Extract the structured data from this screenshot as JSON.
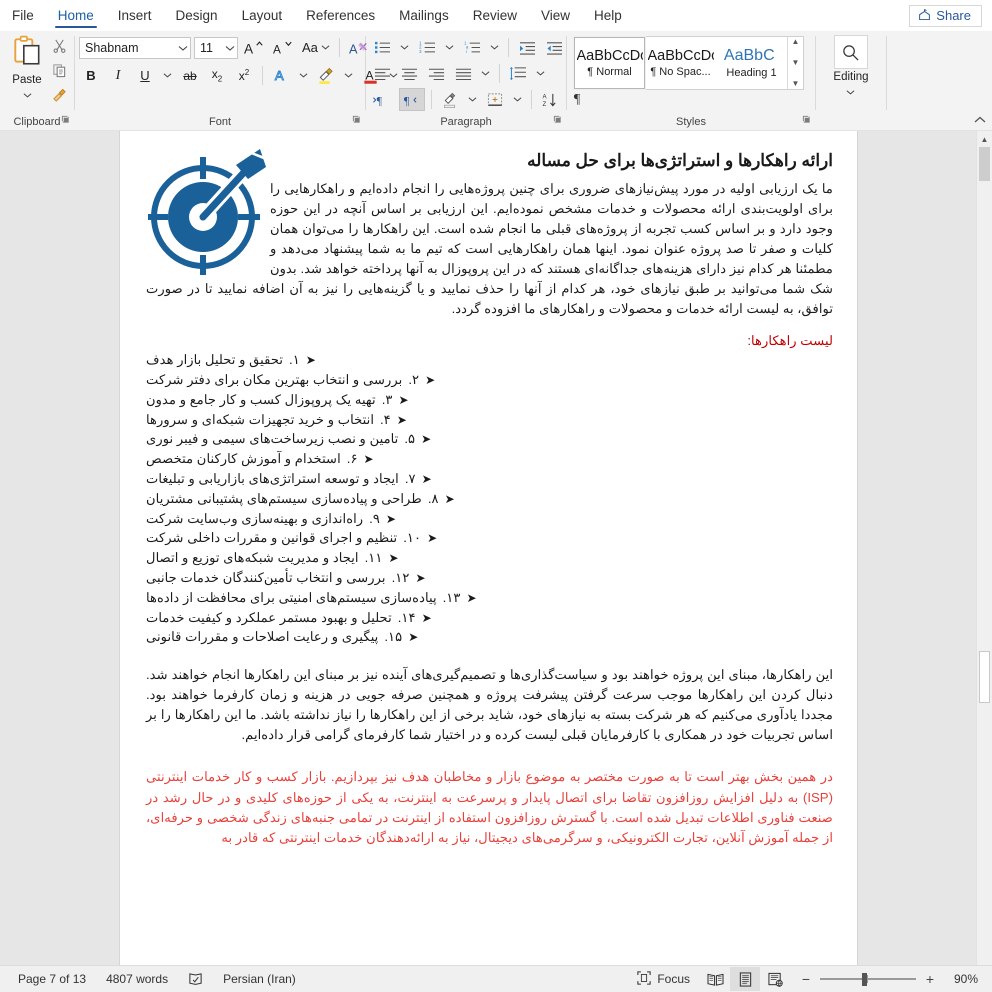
{
  "window": {
    "tabs": [
      {
        "label": "File",
        "active": false
      },
      {
        "label": "Home",
        "active": true
      },
      {
        "label": "Insert",
        "active": false
      },
      {
        "label": "Design",
        "active": false
      },
      {
        "label": "Layout",
        "active": false
      },
      {
        "label": "References",
        "active": false
      },
      {
        "label": "Mailings",
        "active": false
      },
      {
        "label": "Review",
        "active": false
      },
      {
        "label": "View",
        "active": false
      },
      {
        "label": "Help",
        "active": false
      }
    ],
    "share_label": "Share",
    "accent_color": "#2b579a"
  },
  "ribbon": {
    "clipboard": {
      "caption": "Clipboard",
      "paste_label": "Paste",
      "cut_name": "cut-icon",
      "copy_name": "copy-icon",
      "format_painter_name": "format-painter-icon",
      "dialog_launcher": "dialog-launcher-icon"
    },
    "font": {
      "caption": "Font",
      "font_name": "Shabnam",
      "font_size": "11",
      "grow_label": "A",
      "shrink_label": "A",
      "change_case_label": "Aa",
      "clear_format_label": "A",
      "bold_label": "B",
      "italic_label": "I",
      "underline_label": "U",
      "strikethrough_label": "ab",
      "subscript_label": "x",
      "superscript_label": "x",
      "text_effects_label": "A",
      "highlight_label": "highlight",
      "font_color_label": "A",
      "dialog_launcher": "dialog-launcher-icon"
    },
    "paragraph": {
      "caption": "Paragraph",
      "dialog_launcher": "dialog-launcher-icon",
      "rtl_active": true
    },
    "styles": {
      "caption": "Styles",
      "items": [
        {
          "preview": "AaBbCcDc",
          "name": "¶ Normal",
          "selected": true,
          "heading": false
        },
        {
          "preview": "AaBbCcDc",
          "name": "¶ No Spac...",
          "selected": false,
          "heading": false
        },
        {
          "preview": "AaBbC ",
          "name": "Heading 1",
          "selected": false,
          "heading": true
        }
      ],
      "dialog_launcher": "dialog-launcher-icon"
    },
    "editing": {
      "caption": "Editing",
      "label": "Editing"
    },
    "collapse_label": "⌃"
  },
  "document": {
    "heading": "ارائه راهکارها و استراتژی‌ها برای حل مساله",
    "image_alt": "target-and-arrow-graphic",
    "image_color": "#1a6099",
    "intro_paragraph": "ما یک ارزیابی اولیه در مورد پیش‌نیازهای ضروری برای چنین پروژه‌هایی را انجام داده‌ایم و راهکارهایی را برای اولویت‌بندی ارائه محصولات و خدمات مشخص نموده‌ایم. این ارزیابی بر اساس آنچه در این حوزه وجود دارد و بر اساس کسب تجربه از پروژه‌های قبلی ما انجام شده است. این راهکارها را می‌توان همان کلیات و صفر تا صد پروژه عنوان نمود. اینها همان راهکارهایی است که تیم ما به شما پیشنهاد می‌دهد و مطمئنا هر کدام نیز دارای هزینه‌های جداگانه‌ای هستند که در این پروپوزال به آنها پرداخته خواهد شد. بدون شک شما می‌توانید بر طبق نیازهای خود، هر کدام از آنها را حذف نمایید و یا گزینه‌هایی را نیز به آن اضافه نمایید تا در صورت توافق، به لیست ارائه خدمات و محصولات و راهکارهای ما افزوده گردد.",
    "list_title": "لیست راهکارها:",
    "list_title_color": "#c00000",
    "list_marker": "➤",
    "list_items": [
      {
        "num": "۱.",
        "text": "تحقیق و تحلیل بازار هدف"
      },
      {
        "num": "۲.",
        "text": "بررسی و انتخاب بهترین مکان برای دفتر شرکت"
      },
      {
        "num": "۳.",
        "text": "تهیه یک پروپوزال کسب و کار جامع و مدون"
      },
      {
        "num": "۴.",
        "text": "انتخاب و خرید تجهیزات شبکه‌ای و سرورها"
      },
      {
        "num": "۵.",
        "text": "تامین و نصب زیرساخت‌های سیمی و فیبر نوری"
      },
      {
        "num": "۶.",
        "text": "استخدام و آموزش کارکنان متخصص"
      },
      {
        "num": "۷.",
        "text": "ایجاد و توسعه استراتژی‌های بازاریابی و تبلیغات"
      },
      {
        "num": "۸.",
        "text": "طراحی و پیاده‌سازی سیستم‌های پشتیبانی مشتریان"
      },
      {
        "num": "۹.",
        "text": "راه‌اندازی و بهینه‌سازی وب‌سایت شرکت"
      },
      {
        "num": "۱۰.",
        "text": "تنظیم و اجرای قوانین و مقررات داخلی شرکت"
      },
      {
        "num": "۱۱.",
        "text": "ایجاد و مدیریت شبکه‌های توزیع و اتصال"
      },
      {
        "num": "۱۲.",
        "text": "بررسی و انتخاب تأمین‌کنندگان خدمات جانبی"
      },
      {
        "num": "۱۳.",
        "text": "پیاده‌سازی سیستم‌های امنیتی برای محافظت از داده‌ها"
      },
      {
        "num": "۱۴.",
        "text": "تحلیل و بهبود مستمر عملکرد و کیفیت خدمات"
      },
      {
        "num": "۱۵.",
        "text": "پیگیری و رعایت اصلاحات و مقررات قانونی"
      }
    ],
    "after_paragraph": "این راهکارها، مبنای این پروژه خواهند بود و سیاست‌گذاری‌ها و تصمیم‌گیری‌های آینده نیز بر مبنای این راهکارها انجام خواهند شد. دنبال کردن این راهکارها موجب سرعت گرفتن پیشرفت پروژه و همچنین صرفه جویی در هزینه و زمان کارفرما خواهند بود. مجددا یادآوری می‌کنیم که هر شرکت بسته به نیازهای خود، شاید برخی از این راهکارها را نیاز نداشته باشد. ما این راهکارها را بر اساس تجربیات خود در همکاری با کارفرمایان قبلی لیست کرده و در اختیار شما کارفرمای گرامی قرار داده‌ایم.",
    "red_paragraph": "در همین بخش بهتر است تا به صورت مختصر به موضوع بازار و مخاطبان هدف نیز بپردازیم. بازار کسب و کار خدمات اینترنتی (ISP) به دلیل افزایش روزافزون تقاضا برای اتصال پایدار و پرسرعت به اینترنت، به یکی از حوزه‌های کلیدی و در حال رشد در صنعت فناوری اطلاعات تبدیل شده است. با گسترش روزافزون استفاده از اینترنت در تمامی جنبه‌های زندگی شخصی و حرفه‌ای، از جمله آموزش آنلاین، تجارت الکترونیکی، و سرگرمی‌های دیجیتال، نیاز به ارائه‌دهندگان خدمات اینترنتی که قادر به",
    "red_color": "#e8403a"
  },
  "statusbar": {
    "page_label": "Page 7 of 13",
    "word_count": "4807 words",
    "proofing_icon": "proofing-errors-icon",
    "language": "Persian (Iran)",
    "focus_label": "Focus",
    "read_mode_icon": "read-mode-icon",
    "print_layout_icon": "print-layout-icon",
    "web_layout_icon": "web-layout-icon",
    "zoom_out_label": "−",
    "zoom_in_label": "+",
    "zoom_value": "90%"
  }
}
